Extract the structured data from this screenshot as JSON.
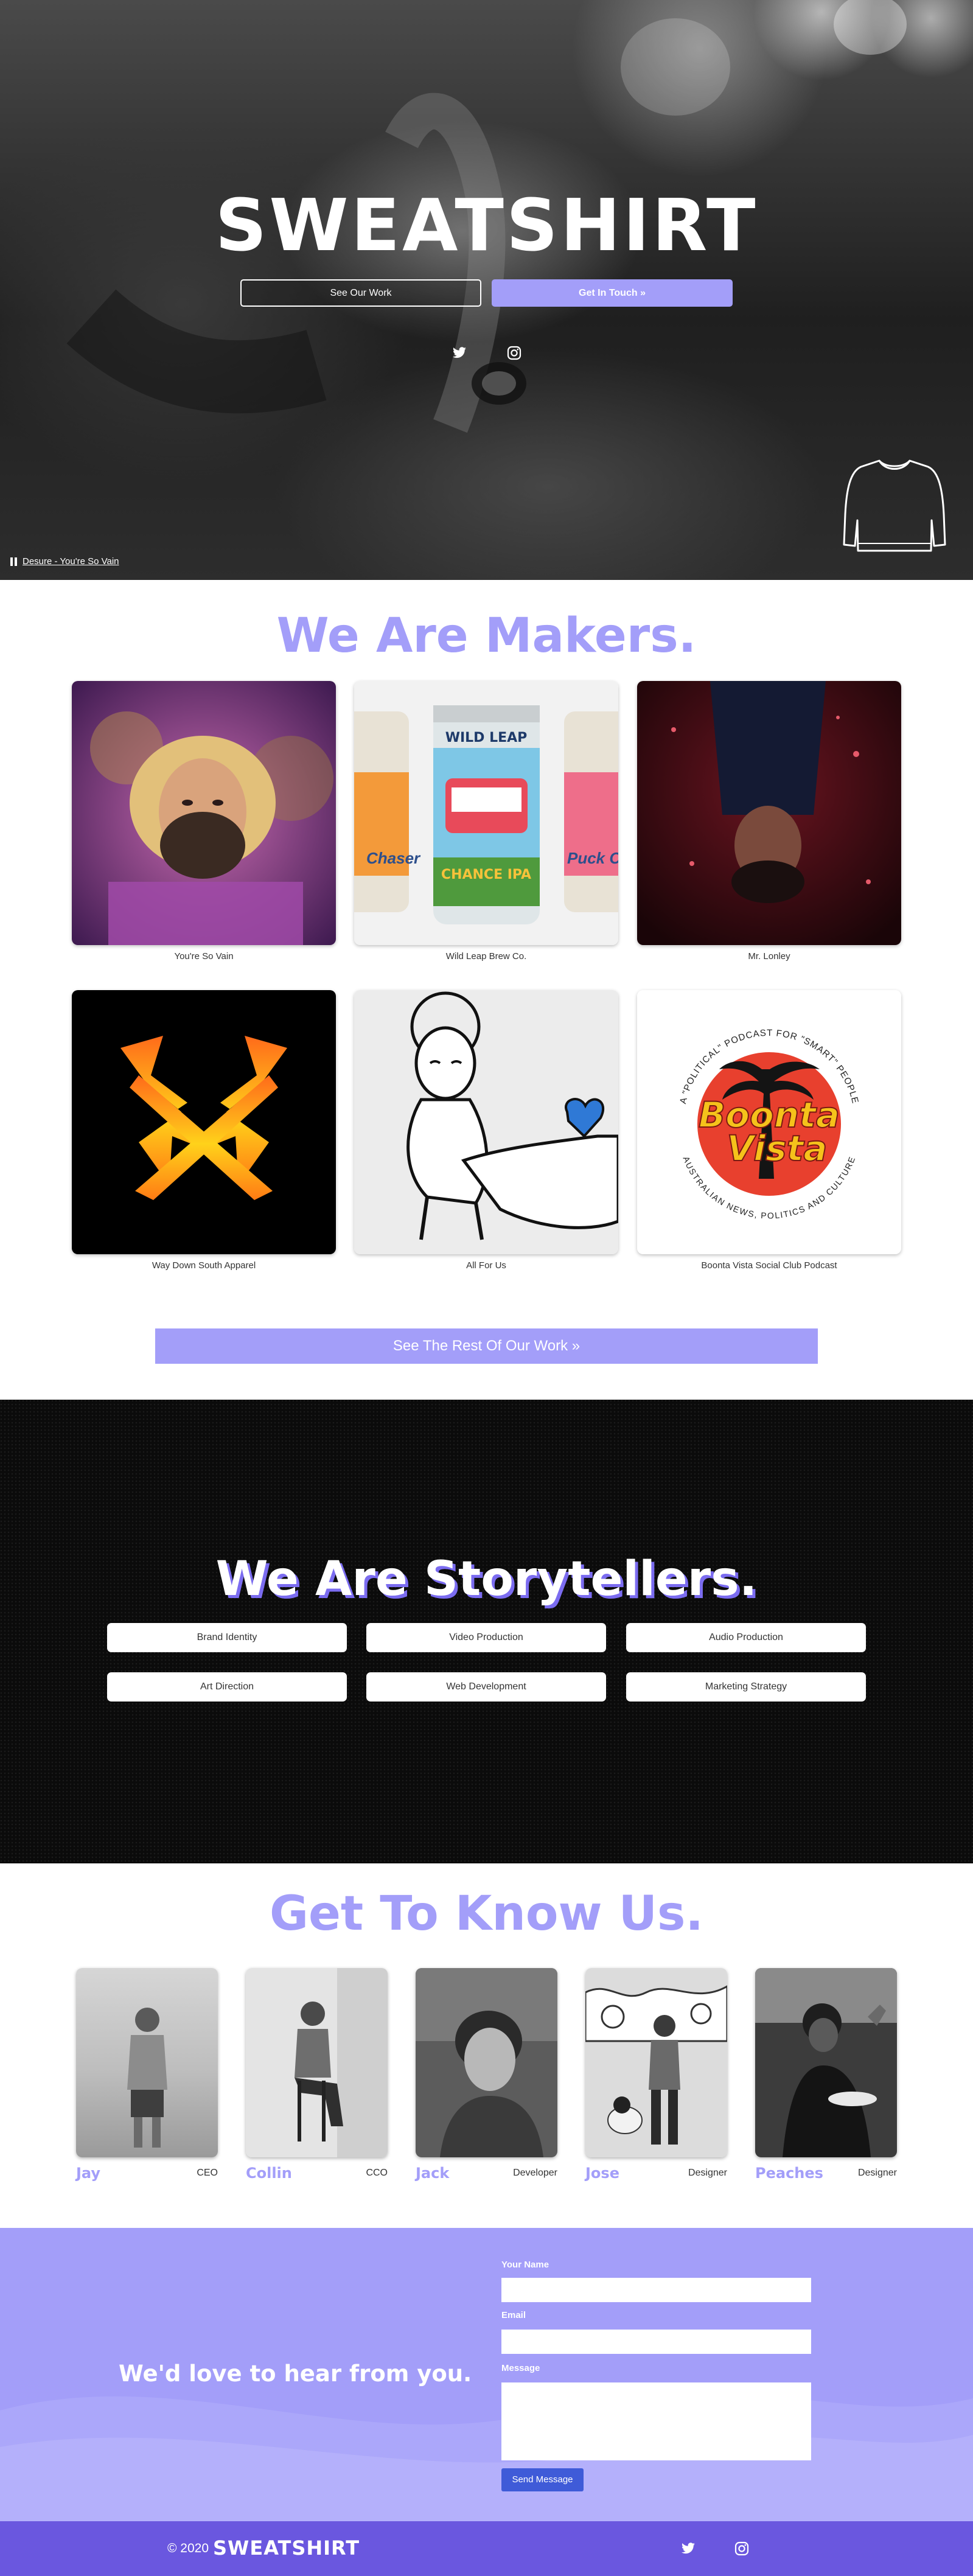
{
  "hero": {
    "logo": "SWEATSHIRT",
    "see_work": "See Our Work",
    "get_in_touch": "Get In Touch »",
    "track": "Desure - You're So Vain"
  },
  "makers": {
    "title": "We Are Makers.",
    "projects": [
      {
        "caption": "You're So Vain"
      },
      {
        "caption": "Wild Leap Brew Co."
      },
      {
        "caption": "Mr. Lonley"
      },
      {
        "caption": "Way Down South Apparel"
      },
      {
        "caption": "All For Us"
      },
      {
        "caption": "Boonta Vista Social Club Podcast"
      }
    ],
    "can_text": {
      "brand": "WILD LEAP",
      "main": "CHANCE IPA",
      "left": "Chaser",
      "right": "Puck C"
    },
    "boonta": {
      "top": "A \"POLITICAL\" PODCAST FOR \"SMART\" PEOPLE",
      "line1": "Boonta",
      "line2": "Vista",
      "bottom": "AUSTRALIAN NEWS, POLITICS AND CULTURE"
    },
    "cta": "See The Rest Of Our Work »"
  },
  "story": {
    "title": "We Are Storytellers.",
    "services": [
      "Brand Identity",
      "Video Production",
      "Audio Production",
      "Art Direction",
      "Web Development",
      "Marketing Strategy"
    ]
  },
  "team": {
    "title": "Get To Know Us.",
    "members": [
      {
        "name": "Jay",
        "role": "CEO"
      },
      {
        "name": "Collin",
        "role": "CCO"
      },
      {
        "name": "Jack",
        "role": "Developer"
      },
      {
        "name": "Jose",
        "role": "Designer"
      },
      {
        "name": "Peaches",
        "role": "Designer"
      }
    ]
  },
  "contact": {
    "heading": "We'd love to hear from you.",
    "name_label": "Your Name",
    "email_label": "Email",
    "message_label": "Message",
    "send": "Send Message"
  },
  "footer": {
    "copyright": "© 2020",
    "logo": "SWEATSHIRT"
  },
  "colors": {
    "accent": "#a39ef9",
    "footer": "#6a57df",
    "send_button": "#3f5bd8"
  }
}
